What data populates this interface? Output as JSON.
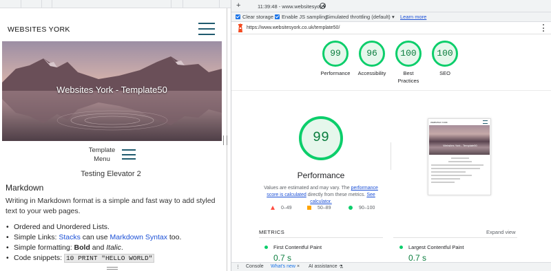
{
  "site": {
    "brand": "WEBSITES YORK",
    "hero_title": "Websites York - Template50",
    "template_menu": [
      "Template",
      "Menu"
    ],
    "page_heading": "Testing Elevator 2",
    "section_heading": "Markdown",
    "paragraph": "Writing in Markdown format is a simple and fast way to add styled text to your web pages.",
    "list": {
      "item1": "Ordered and Unordered Lists.",
      "item2_prefix": "Simple Links: ",
      "item2_link1": "Stacks",
      "item2_mid": " can use ",
      "item2_link2": "Markdown Syntax",
      "item2_suffix": " too.",
      "item3_prefix": "Simple formatting: ",
      "item3_bold": "Bold",
      "item3_mid": " and ",
      "item3_italic": "Italic",
      "item3_suffix": ".",
      "item4_prefix": "Code snippets: ",
      "item4_code": "10 PRINT \"HELLO WORLD\""
    }
  },
  "devtools": {
    "report_selector": "11:39:48 - www.websitesyor:▾",
    "clear_storage": "Clear storage",
    "enable_js_sampling": "Enable JS sampling",
    "throttling": "Simulated throttling (default)",
    "throttling_arrow": "▾",
    "learn_more": "Learn more",
    "url": "https://www.websitesyork.co.uk/template50/",
    "scores": [
      {
        "value": "99",
        "label": "Performance"
      },
      {
        "value": "96",
        "label": "Accessibility"
      },
      {
        "value": "100",
        "label": "Best Practices"
      },
      {
        "value": "100",
        "label": "SEO"
      }
    ],
    "performance": {
      "score": "99",
      "title": "Performance",
      "note_prefix": "Values are estimated and may vary. The ",
      "note_link1": "performance score is calculated",
      "note_mid": " directly from these metrics. ",
      "note_link2": "See calculator."
    },
    "legend": {
      "bad": "0–49",
      "average": "50–89",
      "good": "90–100"
    },
    "thumbnail": {
      "title": "WEBSITES YORK",
      "hero": "Websites York - Template50"
    },
    "metrics": {
      "heading": "METRICS",
      "expand": "Expand view",
      "fcp_label": "First Contentful Paint",
      "fcp_value": "0.7 s",
      "lcp_label": "Largest Contentful Paint",
      "lcp_value": "0.7 s"
    },
    "drawer": {
      "console": "Console",
      "whats_new": "What's new",
      "ai": "AI assistance"
    },
    "colors": {
      "pass": "#0cce6b",
      "average": "#ffa400",
      "fail": "#ff4e42",
      "link": "#1a4fd6"
    }
  }
}
